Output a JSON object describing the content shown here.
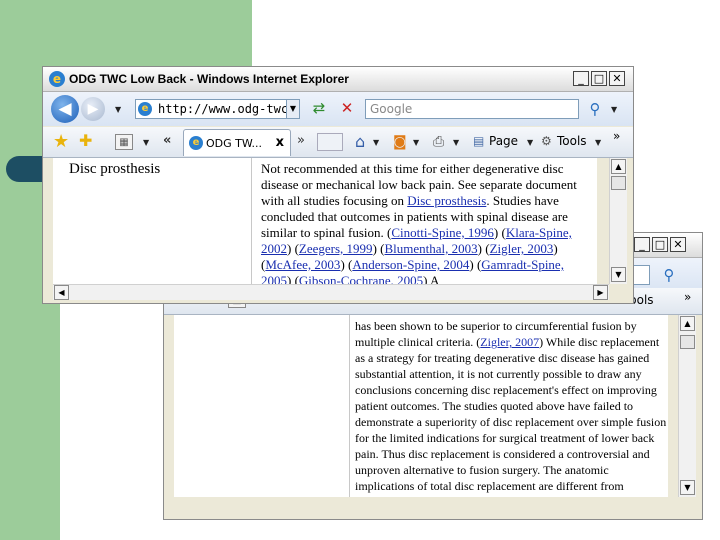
{
  "window_front": {
    "title": "ODG TWC Low Back - Windows Internet Explorer",
    "controls": {
      "minimize": "_",
      "maximize": "□",
      "close": "✕"
    },
    "address_bar": {
      "url": "http://www.odg-twc.co"
    },
    "search": {
      "placeholder": "Google"
    },
    "tab": {
      "title": "ODG TW...",
      "close": "x"
    },
    "toolbar": {
      "page_label": "Page",
      "tools_label": "Tools",
      "more": "»"
    },
    "table": {
      "topic": "Disc prosthesis",
      "text_1": "Not recommended at this time for either degenerative disc disease or mechanical low back pain. See separate document with all studies focusing on ",
      "link_1": "Disc prosthesis",
      "text_2": ". Studies have concluded that outcomes in patients with spinal disease are similar to spinal fusion. (",
      "link_2": "Cinotti-Spine, 1996",
      "text_3": ") (",
      "link_3": "Klara-Spine, 2002",
      "text_4": ") (",
      "link_4": "Zeegers, 1999",
      "text_5": ") (",
      "link_5": "Blumenthal, 2003",
      "text_6": ") (",
      "link_6": "Zigler, 2003",
      "text_7": ") (",
      "link_7": "McAfee, 2003",
      "text_8": ") (",
      "link_8": "Anderson-Spine, 2004",
      "text_9": ") (",
      "link_9": "Gamradt-Spine, 2005",
      "text_10": ") (",
      "link_10": "Gibson-Cochrane, 2005",
      "text_11": ") A"
    }
  },
  "window_back": {
    "controls": {
      "minimize": "_",
      "maximize": "□",
      "close": "✕"
    },
    "tools_label": "Tools",
    "more": "»",
    "text_1": "has been shown to be superior to circumferential fusion by multiple clinical criteria. (",
    "link_1": "Zigler, 2007",
    "text_2": ") While disc replacement as a strategy for treating degenerative disc disease has gained substantial attention, it is not currently possible to draw any conclusions concerning disc replacement's effect on improving patient outcomes. The studies quoted above have failed to demonstrate a superiority of disc replacement over simple fusion for the limited indications for surgical treatment of lower back pain. Thus disc replacement is considered a controversial and unproven alternative to fusion surgery. The anatomic implications of total disc replacement are different from"
  },
  "colors": {
    "slide_green": "#9ccc9a",
    "bullet": "#1d4e63",
    "link": "#1a2fb0"
  }
}
